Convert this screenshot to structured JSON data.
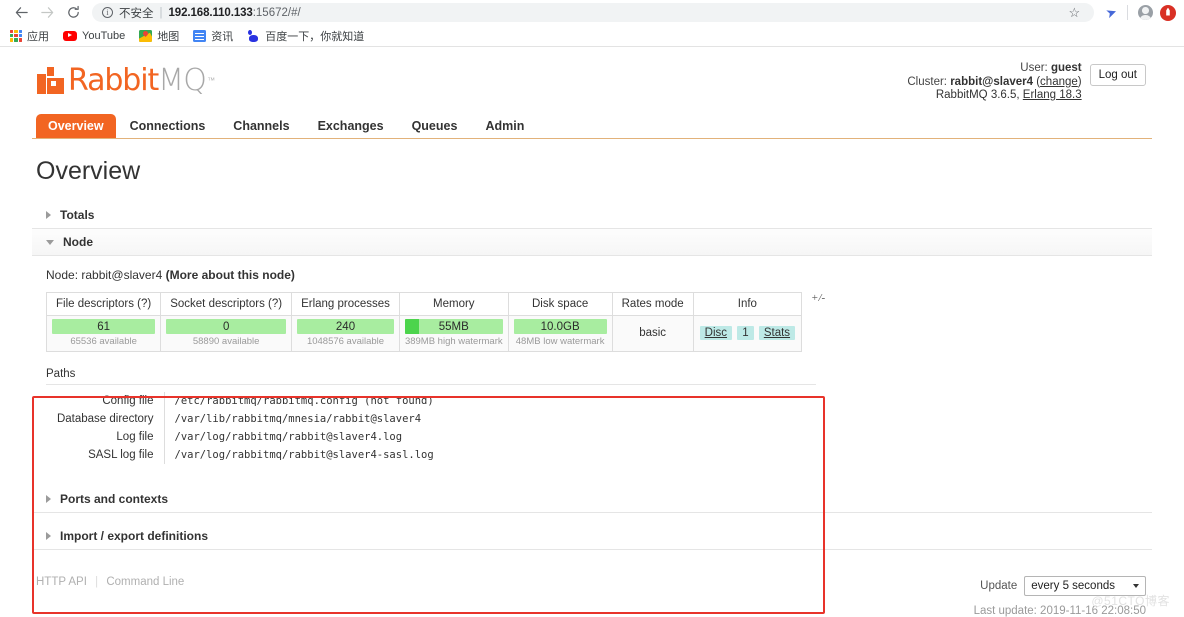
{
  "browser": {
    "back_icon": "back-arrow-icon",
    "forward_icon": "forward-arrow-icon",
    "reload_icon": "reload-icon",
    "security_label": "不安全",
    "url_host": "192.168.110.133",
    "url_rest": ":15672/#/",
    "star_glyph": "☆",
    "bookmarks": [
      {
        "label": "应用",
        "icon": "apps-grid-icon"
      },
      {
        "label": "YouTube",
        "icon": "youtube-icon"
      },
      {
        "label": "地图",
        "icon": "maps-icon"
      },
      {
        "label": "资讯",
        "icon": "news-icon"
      },
      {
        "label": "百度一下，你就知道",
        "icon": "baidu-icon"
      }
    ]
  },
  "header": {
    "logo_primary": "Rabbit",
    "logo_secondary": "MQ",
    "logo_tm": "™",
    "user_label": "User:",
    "user_value": "guest",
    "cluster_label": "Cluster:",
    "cluster_value": "rabbit@slaver4",
    "cluster_change": "change",
    "version_line": "RabbitMQ 3.6.5,",
    "erlang_version": "Erlang 18.3",
    "logout_label": "Log out"
  },
  "nav": {
    "tabs": [
      {
        "label": "Overview",
        "active": true
      },
      {
        "label": "Connections",
        "active": false
      },
      {
        "label": "Channels",
        "active": false
      },
      {
        "label": "Exchanges",
        "active": false
      },
      {
        "label": "Queues",
        "active": false
      },
      {
        "label": "Admin",
        "active": false
      }
    ]
  },
  "main": {
    "page_title": "Overview",
    "sections": {
      "totals": "Totals",
      "node": "Node",
      "ports_contexts": "Ports and contexts",
      "import_export": "Import / export definitions"
    },
    "node": {
      "node_prefix": "Node:",
      "node_name": "rabbit@slaver4",
      "more_link": "(More about this node)",
      "plus_minus": "+/-",
      "columns": [
        "File descriptors (?)",
        "Socket descriptors (?)",
        "Erlang processes",
        "Memory",
        "Disk space",
        "Rates mode",
        "Info"
      ],
      "metrics": [
        {
          "name": "file-descriptors",
          "value": "61",
          "sub": "65536 available",
          "fill_pct": 0
        },
        {
          "name": "socket-descriptors",
          "value": "0",
          "sub": "58890 available",
          "fill_pct": 0
        },
        {
          "name": "erlang-processes",
          "value": "240",
          "sub": "1048576 available",
          "fill_pct": 0
        },
        {
          "name": "memory",
          "value": "55MB",
          "sub": "389MB high watermark",
          "fill_pct": 14
        },
        {
          "name": "disk-space",
          "value": "10.0GB",
          "sub": "48MB low watermark",
          "fill_pct": 0
        }
      ],
      "rates_mode": "basic",
      "info_badges": [
        "Disc",
        "1",
        "Stats"
      ]
    },
    "paths": {
      "title": "Paths",
      "rows": [
        {
          "label": "Config file",
          "value": "/etc/rabbitmq/rabbitmq.config (not found)"
        },
        {
          "label": "Database directory",
          "value": "/var/lib/rabbitmq/mnesia/rabbit@slaver4"
        },
        {
          "label": "Log file",
          "value": "/var/log/rabbitmq/rabbit@slaver4.log"
        },
        {
          "label": "SASL log file",
          "value": "/var/log/rabbitmq/rabbit@slaver4-sasl.log"
        }
      ]
    }
  },
  "footer": {
    "http_api": "HTTP API",
    "command_line": "Command Line",
    "update_label": "Update",
    "update_value": "every 5 seconds",
    "last_update": "Last update: 2019-11-16 22:08:50"
  },
  "watermark": "@51CTO博客",
  "colors": {
    "brand_orange": "#f26522",
    "bar_light": "#a8eda0",
    "bar_dark": "#4cd44c",
    "badge": "#bde9e6",
    "annotation_red": "#e8332a"
  }
}
